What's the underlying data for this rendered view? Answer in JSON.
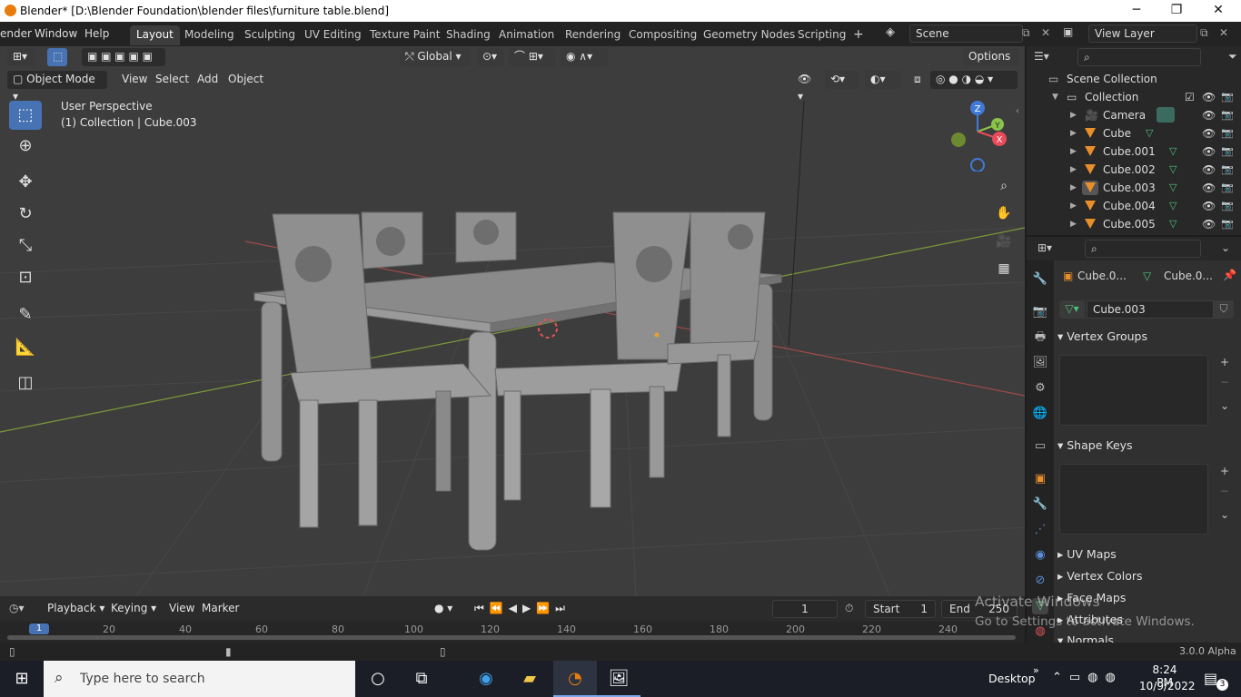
{
  "window": {
    "title": "Blender* [D:\\Blender Foundation\\blender files\\furniture table.blend]",
    "minimize": "─",
    "maximize": "❐",
    "close": "✕"
  },
  "menus": [
    "ender",
    "Window",
    "Help"
  ],
  "workspaces": [
    "Layout",
    "Modeling",
    "Sculpting",
    "UV Editing",
    "Texture Paint",
    "Shading",
    "Animation",
    "Rendering",
    "Compositing",
    "Geometry Nodes",
    "Scripting"
  ],
  "workspace_add": "+",
  "scene": {
    "label": "Scene",
    "view_layer": "View Layer"
  },
  "viewport": {
    "mode": "Object Mode",
    "menus": [
      "View",
      "Select",
      "Add",
      "Object"
    ],
    "transform_orientation": "Global",
    "options": "Options",
    "info_line1": "User Perspective",
    "info_line2": "(1) Collection | Cube.003",
    "gizmo": {
      "z": "Z",
      "y": "Y",
      "x": "X"
    }
  },
  "outliner": {
    "root": "Scene Collection",
    "collection": "Collection",
    "items": [
      {
        "name": "Camera",
        "type": "camera"
      },
      {
        "name": "Cube",
        "type": "mesh"
      },
      {
        "name": "Cube.001",
        "type": "mesh"
      },
      {
        "name": "Cube.002",
        "type": "mesh"
      },
      {
        "name": "Cube.003",
        "type": "mesh"
      },
      {
        "name": "Cube.004",
        "type": "mesh"
      },
      {
        "name": "Cube.005",
        "type": "mesh"
      }
    ]
  },
  "properties": {
    "breadcrumb_object": "Cube.0...",
    "breadcrumb_data": "Cube.0...",
    "mesh_name": "Cube.003",
    "panels": {
      "vertex_groups": "Vertex Groups",
      "shape_keys": "Shape Keys",
      "uv_maps": "UV Maps",
      "vertex_colors": "Vertex Colors",
      "face_maps": "Face Maps",
      "attributes": "Attributes",
      "normals": "Normals"
    }
  },
  "timeline": {
    "menus": [
      "Playback",
      "Keying",
      "View",
      "Marker"
    ],
    "current_frame": "1",
    "start_label": "Start",
    "start": "1",
    "end_label": "End",
    "end": "250",
    "ruler": [
      "1",
      "20",
      "40",
      "60",
      "80",
      "100",
      "120",
      "140",
      "160",
      "180",
      "200",
      "220",
      "240"
    ]
  },
  "status": {
    "version": "3.0.0 Alpha"
  },
  "watermark": {
    "line1": "Activate Windows",
    "line2": "Go to Settings to activate Windows."
  },
  "taskbar": {
    "search_placeholder": "Type here to search",
    "desktop": "Desktop",
    "time": "8:24 PM",
    "date": "10/9/2022",
    "notifications": "3"
  },
  "colors": {
    "accent": "#4772b3",
    "mesh_icon": "#e88f2c",
    "x_axis": "#e84b5a",
    "y_axis": "#8bc34a",
    "z_axis": "#3f7ad8"
  }
}
